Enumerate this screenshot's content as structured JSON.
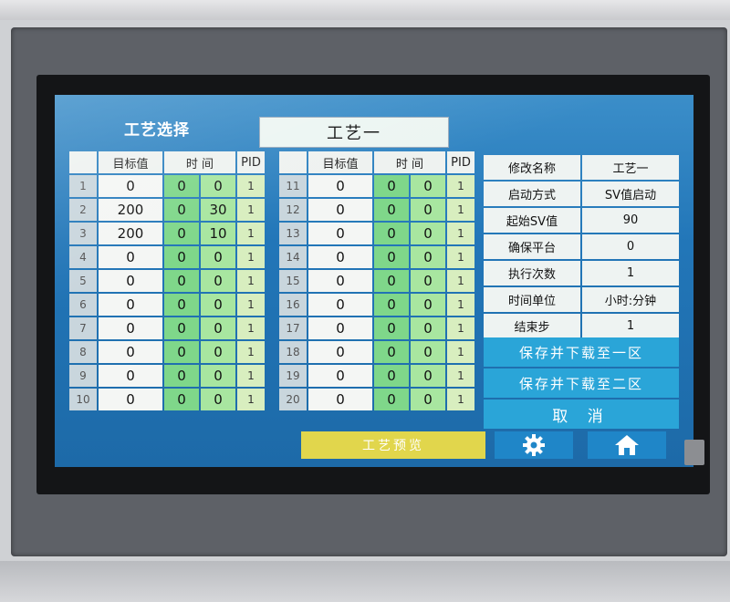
{
  "screen": {
    "title": "工艺选择",
    "recipe_name": "工艺一"
  },
  "table": {
    "headers": {
      "target": "目标值",
      "time": "时 间",
      "pid": "PID"
    },
    "left_rows": [
      {
        "idx": "1",
        "target": "0",
        "h": "0",
        "m": "0",
        "pid": "1"
      },
      {
        "idx": "2",
        "target": "200",
        "h": "0",
        "m": "30",
        "pid": "1"
      },
      {
        "idx": "3",
        "target": "200",
        "h": "0",
        "m": "10",
        "pid": "1"
      },
      {
        "idx": "4",
        "target": "0",
        "h": "0",
        "m": "0",
        "pid": "1"
      },
      {
        "idx": "5",
        "target": "0",
        "h": "0",
        "m": "0",
        "pid": "1"
      },
      {
        "idx": "6",
        "target": "0",
        "h": "0",
        "m": "0",
        "pid": "1"
      },
      {
        "idx": "7",
        "target": "0",
        "h": "0",
        "m": "0",
        "pid": "1"
      },
      {
        "idx": "8",
        "target": "0",
        "h": "0",
        "m": "0",
        "pid": "1"
      },
      {
        "idx": "9",
        "target": "0",
        "h": "0",
        "m": "0",
        "pid": "1"
      },
      {
        "idx": "10",
        "target": "0",
        "h": "0",
        "m": "0",
        "pid": "1"
      }
    ],
    "right_rows": [
      {
        "idx": "11",
        "target": "0",
        "h": "0",
        "m": "0",
        "pid": "1"
      },
      {
        "idx": "12",
        "target": "0",
        "h": "0",
        "m": "0",
        "pid": "1"
      },
      {
        "idx": "13",
        "target": "0",
        "h": "0",
        "m": "0",
        "pid": "1"
      },
      {
        "idx": "14",
        "target": "0",
        "h": "0",
        "m": "0",
        "pid": "1"
      },
      {
        "idx": "15",
        "target": "0",
        "h": "0",
        "m": "0",
        "pid": "1"
      },
      {
        "idx": "16",
        "target": "0",
        "h": "0",
        "m": "0",
        "pid": "1"
      },
      {
        "idx": "17",
        "target": "0",
        "h": "0",
        "m": "0",
        "pid": "1"
      },
      {
        "idx": "18",
        "target": "0",
        "h": "0",
        "m": "0",
        "pid": "1"
      },
      {
        "idx": "19",
        "target": "0",
        "h": "0",
        "m": "0",
        "pid": "1"
      },
      {
        "idx": "20",
        "target": "0",
        "h": "0",
        "m": "0",
        "pid": "1"
      }
    ]
  },
  "params": [
    {
      "label": "修改名称",
      "value": "工艺一"
    },
    {
      "label": "启动方式",
      "value": "SV值启动"
    },
    {
      "label": "起始SV值",
      "value": "90"
    },
    {
      "label": "确保平台",
      "value": "0"
    },
    {
      "label": "执行次数",
      "value": "1"
    },
    {
      "label": "时间单位",
      "value": "小时:分钟"
    },
    {
      "label": "结束步",
      "value": "1"
    }
  ],
  "actions": {
    "save_zone1": "保存并下载至一区",
    "save_zone2": "保存并下载至二区",
    "cancel": "取 消",
    "preview": "工艺预览"
  },
  "icons": [
    "gear-icon",
    "home-icon"
  ],
  "colors": {
    "screen_bg": "#2276b8",
    "time_cell": "#7fd78a",
    "preview_btn": "#e1d64c",
    "action_btn": "#2aa5d8"
  }
}
